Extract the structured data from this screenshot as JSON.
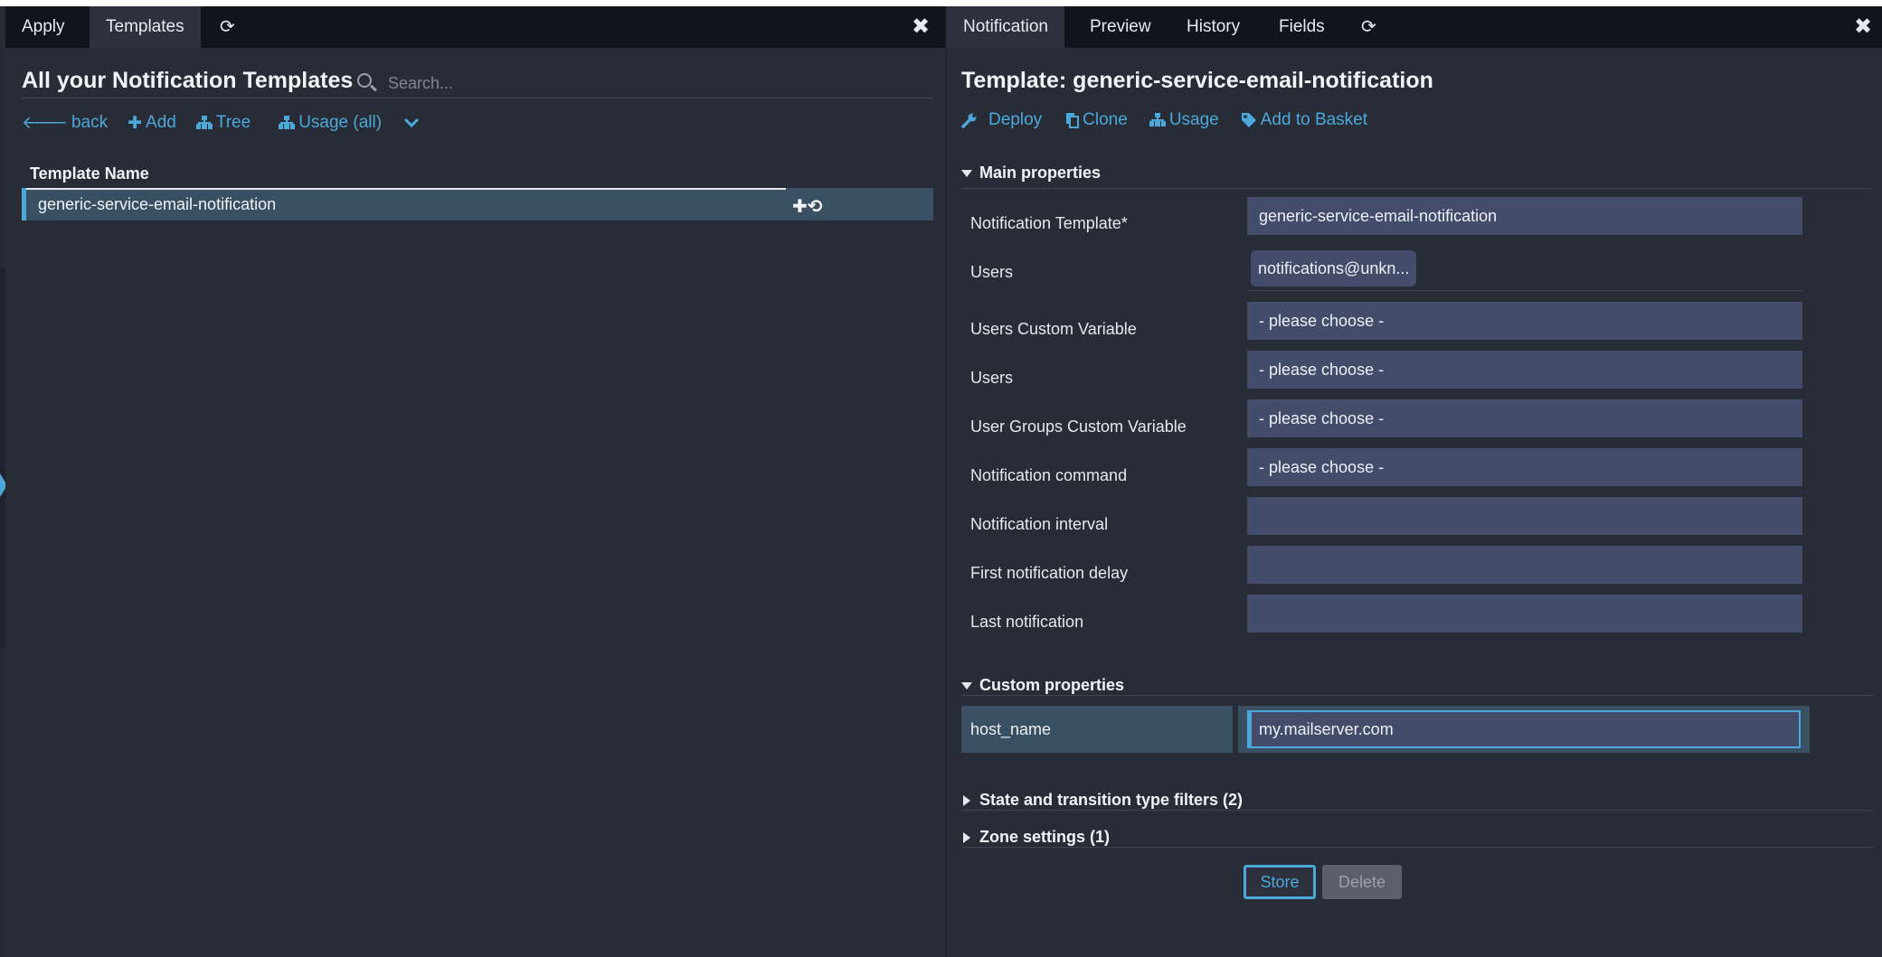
{
  "left_panel": {
    "tabs": [
      {
        "label": "Apply"
      },
      {
        "label": "Templates"
      },
      {
        "label": "⟳"
      }
    ],
    "close_glyph": "✖",
    "title": "All your Notification Templates",
    "search": {
      "placeholder": "Search..."
    },
    "actions": {
      "back": "back",
      "add": "Add",
      "tree": "Tree",
      "usage": "Usage (all)"
    },
    "table": {
      "header": "Template Name",
      "rows": [
        {
          "name": "generic-service-email-notification",
          "actions": "✚⟲"
        }
      ]
    }
  },
  "right_panel": {
    "tabs": [
      {
        "label": "Notification"
      },
      {
        "label": "Preview"
      },
      {
        "label": "History"
      },
      {
        "label": "Fields"
      },
      {
        "label": "⟳"
      }
    ],
    "close_glyph": "✖",
    "title": "Template: generic-service-email-notification",
    "actions": {
      "deploy": "Deploy",
      "clone": "Clone",
      "usage": "Usage",
      "basket": "Add to Basket"
    },
    "sections": {
      "main": "Main properties",
      "custom": "Custom properties",
      "filters": "State and transition type filters (2)",
      "zone": "Zone settings (1)"
    },
    "fields": {
      "template": {
        "label": "Notification Template*",
        "value": "generic-service-email-notification"
      },
      "users_chip": {
        "label": "Users",
        "value": "notifications@unkn..."
      },
      "users_custom_var": {
        "label": "Users Custom Variable",
        "value": "- please choose -"
      },
      "users": {
        "label": "Users",
        "value": "- please choose -"
      },
      "user_groups_custom_var": {
        "label": "User Groups Custom Variable",
        "value": "- please choose -"
      },
      "notification_command": {
        "label": "Notification command",
        "value": "- please choose -"
      },
      "notification_interval": {
        "label": "Notification interval",
        "value": ""
      },
      "first_delay": {
        "label": "First notification delay",
        "value": ""
      },
      "last_notification": {
        "label": "Last notification",
        "value": ""
      }
    },
    "custom": {
      "label": "host_name",
      "value": "my.mailserver.com"
    },
    "buttons": {
      "store": "Store",
      "delete": "Delete"
    }
  },
  "colors": {
    "accent": "#4ba8d8",
    "background": "#282c37",
    "tabbar": "#11141c",
    "field": "#434d6b",
    "selected_row": "#395063"
  }
}
